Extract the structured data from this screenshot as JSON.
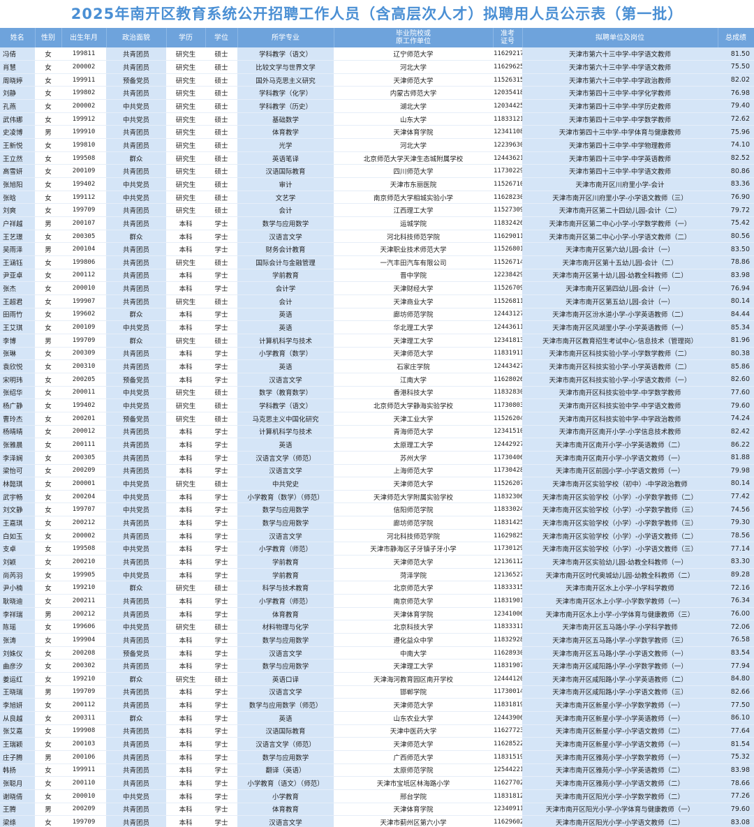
{
  "title": "2025年南开区教育系统公开招聘工作人员（含高层次人才）拟聘用人员公示表（第一批）",
  "headers": [
    "姓名",
    "性别",
    "出生年月",
    "政治面貌",
    "学历",
    "学位",
    "所学专业",
    "毕业院校或\n原工作单位",
    "准考\n证号",
    "拟聘单位及岗位",
    "总成绩"
  ],
  "rows": [
    [
      "冯倩",
      "女",
      "199811",
      "共青团员",
      "研究生",
      "硕士",
      "学科教学（语文）",
      "辽宁师范大学",
      "11629217",
      "天津市第六十三中学-中学语文教师",
      "81.50"
    ],
    [
      "肖慧",
      "女",
      "200002",
      "共青团员",
      "研究生",
      "硕士",
      "比较文学与世界文学",
      "河北大学",
      "11629625",
      "天津市第六十三中学-中学语文教师",
      "75.50"
    ],
    [
      "周晓婷",
      "女",
      "199911",
      "预备党员",
      "研究生",
      "硕士",
      "国外马克思主义研究",
      "天津师范大学",
      "11526315",
      "天津市第六十三中学-中学政治教师",
      "82.02"
    ],
    [
      "刘静",
      "女",
      "199802",
      "共青团员",
      "研究生",
      "硕士",
      "学科教学（化学）",
      "内蒙古师范大学",
      "12035418",
      "天津市第四十三中学-中学化学教师",
      "76.98"
    ],
    [
      "孔燕",
      "女",
      "200002",
      "中共党员",
      "研究生",
      "硕士",
      "学科教学（历史）",
      "湖北大学",
      "12034425",
      "天津市第四十三中学-中学历史教师",
      "79.40"
    ],
    [
      "武伟娜",
      "女",
      "199912",
      "中共党员",
      "研究生",
      "硕士",
      "基础数学",
      "山东大学",
      "11833121",
      "天津市第四十三中学-中学数学教师",
      "72.62"
    ],
    [
      "史凌博",
      "男",
      "199910",
      "共青团员",
      "研究生",
      "硕士",
      "体育教学",
      "天津体育学院",
      "12341108",
      "天津市第四十三中学-中学体育与健康教师",
      "75.96"
    ],
    [
      "王新悦",
      "女",
      "199810",
      "共青团员",
      "研究生",
      "硕士",
      "光学",
      "河北大学",
      "12239630",
      "天津市第四十三中学-中学物理教师",
      "74.10"
    ],
    [
      "王立然",
      "女",
      "199508",
      "群众",
      "研究生",
      "硕士",
      "英语笔译",
      "北京师范大学天津生态城附属学校",
      "12443621",
      "天津市第四十三中学-中学英语教师",
      "82.52"
    ],
    [
      "高雪妍",
      "女",
      "200109",
      "共青团员",
      "研究生",
      "硕士",
      "汉语国际教育",
      "四川师范大学",
      "11730229",
      "天津市第四十三中学-中学语文教师",
      "80.86"
    ],
    [
      "张旭阳",
      "女",
      "199402",
      "中共党员",
      "研究生",
      "硕士",
      "审计",
      "天津市东丽医院",
      "11526710",
      "天津市南开区川府里小学-会计",
      "83.36"
    ],
    [
      "张晗",
      "女",
      "199112",
      "中共党员",
      "研究生",
      "硕士",
      "文艺学",
      "南京师范大学相城实验小学",
      "11628230",
      "天津市南开区川府里小学-小学语文教师（三）",
      "76.90"
    ],
    [
      "刘爽",
      "女",
      "199709",
      "共青团员",
      "研究生",
      "硕士",
      "会计",
      "江西理工大学",
      "11527309",
      "天津市南开区第二十四幼儿园-会计（二）",
      "79.72"
    ],
    [
      "户祥越",
      "男",
      "200107",
      "共青团员",
      "本科",
      "学士",
      "数学与应用数学",
      "运城学院",
      "11832426",
      "天津市南开区第二中心小学-小学数学教师（一）",
      "75.42"
    ],
    [
      "王艺璟",
      "女",
      "200305",
      "群众",
      "本科",
      "学士",
      "汉语言文学",
      "河北科技师范学院",
      "11629011",
      "天津市南开区第二中心小学-小学语文教师（二）",
      "80.56"
    ],
    [
      "吴雨泽",
      "男",
      "200104",
      "共青团员",
      "本科",
      "学士",
      "财务会计教育",
      "天津职业技术师范大学",
      "11526801",
      "天津市南开区第六幼儿园-会计（一）",
      "83.50"
    ],
    [
      "王涵钰",
      "女",
      "199806",
      "共青团员",
      "研究生",
      "硕士",
      "国际会计与金融管理",
      "一汽丰田汽车有限公司",
      "11526714",
      "天津市南开区第十五幼儿园-会计（二）",
      "78.86"
    ],
    [
      "尹亚卓",
      "女",
      "200112",
      "共青团员",
      "本科",
      "学士",
      "学前教育",
      "晋中学院",
      "12238429",
      "天津市南开区第十幼儿园-幼教全科教师（二）",
      "83.98"
    ],
    [
      "张杰",
      "女",
      "200010",
      "共青团员",
      "本科",
      "学士",
      "会计学",
      "天津财经大学",
      "11526709",
      "天津市南开区第四幼儿园-会计（一）",
      "76.94"
    ],
    [
      "王超君",
      "女",
      "199907",
      "共青团员",
      "研究生",
      "硕士",
      "会计",
      "天津商业大学",
      "11526811",
      "天津市南开区第五幼儿园-会计（一）",
      "80.14"
    ],
    [
      "田雨竹",
      "女",
      "199602",
      "群众",
      "本科",
      "学士",
      "英语",
      "廊坊师范学院",
      "12443127",
      "天津市南开区汾水道小学-小学英语教师（二）",
      "84.44"
    ],
    [
      "王艾琪",
      "女",
      "200109",
      "中共党员",
      "本科",
      "学士",
      "英语",
      "华北理工大学",
      "12443611",
      "天津市南开区风湖里小学-小学英语教师（一）",
      "85.34"
    ],
    [
      "李博",
      "男",
      "199709",
      "群众",
      "研究生",
      "硕士",
      "计算机科学与技术",
      "天津理工大学",
      "12341813",
      "天津市南开区教育招生考试中心-信息技术（管理岗）",
      "81.96"
    ],
    [
      "张琳",
      "女",
      "200309",
      "共青团员",
      "本科",
      "学士",
      "小学教育（数学）",
      "天津师范大学",
      "11831911",
      "天津市南开区科技实验小学-小学数学教师（二）",
      "80.38"
    ],
    [
      "袁欣悦",
      "女",
      "200310",
      "共青团员",
      "本科",
      "学士",
      "英语",
      "石家庄学院",
      "12443427",
      "天津市南开区科技实验小学-小学英语教师（二）",
      "85.86"
    ],
    [
      "宋明玮",
      "女",
      "200205",
      "预备党员",
      "本科",
      "学士",
      "汉语言文学",
      "江南大学",
      "11628026",
      "天津市南开区科技实验小学-小学语文教师（一）",
      "82.60"
    ],
    [
      "张绍华",
      "女",
      "200011",
      "中共党员",
      "研究生",
      "硕士",
      "数学（教育数学）",
      "香港科技大学",
      "11832830",
      "天津市南开区科技实验中学-中学数学教师",
      "77.60"
    ],
    [
      "杨广静",
      "女",
      "199402",
      "中共党员",
      "研究生",
      "硕士",
      "学科教学（语文）",
      "北京师范大学静海实验学校",
      "11730803",
      "天津市南开区科技实验中学-中学语文教师",
      "79.60"
    ],
    [
      "曹玲杰",
      "女",
      "200201",
      "预备党员",
      "研究生",
      "硕士",
      "马克思主义中国化研究",
      "天津工业大学",
      "11526204",
      "天津市南开区科技实验中学-中学政治教师",
      "74.24"
    ],
    [
      "杨晴晴",
      "女",
      "200012",
      "共青团员",
      "本科",
      "学士",
      "计算机科学与技术",
      "青海师范大学",
      "12341510",
      "天津市南开区南开小学-小学信息技术教师",
      "82.42"
    ],
    [
      "张雅晨",
      "女",
      "200111",
      "共青团员",
      "本科",
      "学士",
      "英语",
      "太原理工大学",
      "12442927",
      "天津市南开区南开小学-小学英语教师（二）",
      "86.22"
    ],
    [
      "李泽娴",
      "女",
      "200305",
      "共青团员",
      "本科",
      "学士",
      "汉语言文学（师范）",
      "苏州大学",
      "11730406",
      "天津市南开区南开小学-小学语文教师（一）",
      "81.88"
    ],
    [
      "梁怡可",
      "女",
      "200209",
      "共青团员",
      "本科",
      "学士",
      "汉语言文学",
      "上海师范大学",
      "11730428",
      "天津市南开区前园小学-小学语文教师（一）",
      "79.98"
    ],
    [
      "林懿琪",
      "女",
      "200001",
      "中共党员",
      "研究生",
      "硕士",
      "中共党史",
      "天津师范大学",
      "11526207",
      "天津市南开区实验学校（初中）-中学政治教师",
      "80.14"
    ],
    [
      "武宇畅",
      "女",
      "200204",
      "中共党员",
      "本科",
      "学士",
      "小学教育（数学）（师范）",
      "天津师范大学附属实验学校",
      "11832306",
      "天津市南开区实验学校（小学）-小学数学教师（二）",
      "77.42"
    ],
    [
      "刘文静",
      "女",
      "199707",
      "中共党员",
      "本科",
      "学士",
      "数学与应用数学",
      "信阳师范学院",
      "11833024",
      "天津市南开区实验学校（小学）-小学数学教师（三）",
      "74.56"
    ],
    [
      "王嘉琪",
      "女",
      "200212",
      "共青团员",
      "本科",
      "学士",
      "数学与应用数学",
      "廊坊师范学院",
      "11831425",
      "天津市南开区实验学校（小学）-小学数学教师（三）",
      "79.30"
    ],
    [
      "白如玉",
      "女",
      "200002",
      "共青团员",
      "本科",
      "学士",
      "汉语言文学",
      "河北科技师范学院",
      "11629825",
      "天津市南开区实验学校（小学）-小学语文教师（二）",
      "78.56"
    ],
    [
      "支卓",
      "女",
      "199508",
      "中共党员",
      "本科",
      "学士",
      "小学教育（师范）",
      "天津市静海区子牙镇子牙小学",
      "11730129",
      "天津市南开区实验学校（小学）-小学语文教师（三）",
      "77.14"
    ],
    [
      "刘颖",
      "女",
      "200210",
      "共青团员",
      "本科",
      "学士",
      "学前教育",
      "天津师范大学",
      "12136112",
      "天津市南开区实验幼儿园-幼教全科教师（一）",
      "83.30"
    ],
    [
      "尚芮羽",
      "女",
      "199905",
      "中共党员",
      "本科",
      "学士",
      "学前教育",
      "菏泽学院",
      "12136527",
      "天津市南开区时代奥城幼儿园-幼教全科教师（二）",
      "89.28"
    ],
    [
      "尹小楠",
      "女",
      "199210",
      "群众",
      "研究生",
      "硕士",
      "科学与技术教育",
      "北京师范大学",
      "11833315",
      "天津市南开区水上小学-小学科学教师",
      "72.16"
    ],
    [
      "耿晓迪",
      "女",
      "200211",
      "共青团员",
      "本科",
      "学士",
      "小学教育（师范）",
      "南京师范大学",
      "11831901",
      "天津市南开区水上小学-小学数学教师（一）",
      "76.34"
    ],
    [
      "李祥瑞",
      "男",
      "200212",
      "共青团员",
      "本科",
      "学士",
      "体育教育",
      "天津体育学院",
      "12341006",
      "天津市南开区水上小学-小学体育与健康教师（三）",
      "76.00"
    ],
    [
      "陈瑶",
      "女",
      "199606",
      "中共党员",
      "研究生",
      "硕士",
      "材料物理与化学",
      "北京科技大学",
      "11833311",
      "天津市南开区五马路小学-小学科学教师",
      "72.06"
    ],
    [
      "张涛",
      "女",
      "199904",
      "共青团员",
      "本科",
      "学士",
      "数学与应用数学",
      "遵化益众中学",
      "11832928",
      "天津市南开区五马路小学-小学数学教师（三）",
      "76.58"
    ],
    [
      "刘姝仪",
      "女",
      "200208",
      "预备党员",
      "本科",
      "学士",
      "汉语言文学",
      "中南大学",
      "11628930",
      "天津市南开区五马路小学-小学语文教师（一）",
      "83.54"
    ],
    [
      "曲彦汐",
      "女",
      "200302",
      "共青团员",
      "本科",
      "学士",
      "数学与应用数学",
      "天津理工大学",
      "11831907",
      "天津市南开区咸阳路小学-小学数学教师（一）",
      "77.94"
    ],
    [
      "姜运红",
      "女",
      "199210",
      "群众",
      "研究生",
      "硕士",
      "英语口译",
      "天津海河教育园区南开学校",
      "12444120",
      "天津市南开区咸阳路小学-小学英语教师（二）",
      "84.80"
    ],
    [
      "王晓瑞",
      "男",
      "199709",
      "共青团员",
      "本科",
      "学士",
      "汉语言文学",
      "邯郸学院",
      "11730014",
      "天津市南开区咸阳路小学-小学语文教师（三）",
      "82.66"
    ],
    [
      "李旭妍",
      "女",
      "200112",
      "共青团员",
      "本科",
      "学士",
      "数学与应用数学（师范）",
      "天津师范大学",
      "11831819",
      "天津市南开区新星小学-小学数学教师（一）",
      "77.50"
    ],
    [
      "从良越",
      "女",
      "200311",
      "群众",
      "本科",
      "学士",
      "英语",
      "山东农业大学",
      "12443906",
      "天津市南开区新星小学-小学英语教师（一）",
      "86.10"
    ],
    [
      "张艾嘉",
      "女",
      "199908",
      "共青团员",
      "本科",
      "学士",
      "汉语国际教育",
      "天津中医药大学",
      "11627723",
      "天津市南开区新星小学-小学语文教师（二）",
      "77.64"
    ],
    [
      "王瑞颖",
      "女",
      "200103",
      "共青团员",
      "本科",
      "学士",
      "汉语言文学（师范）",
      "天津师范大学",
      "11628522",
      "天津市南开区新星小学-小学语文教师（一）",
      "81.54"
    ],
    [
      "庄子腾",
      "男",
      "200106",
      "共青团员",
      "本科",
      "学士",
      "数学与应用数学",
      "广西师范大学",
      "11831519",
      "天津市南开区雅苑小学-小学数学教师（一）",
      "75.32"
    ],
    [
      "韩扬",
      "女",
      "199911",
      "共青团员",
      "本科",
      "学士",
      "翻译（英语）",
      "太原师范学院",
      "12544221",
      "天津市南开区雅苑小学-小学英语教师（二）",
      "83.98"
    ],
    [
      "张聪月",
      "女",
      "200110",
      "共青团员",
      "本科",
      "学士",
      "小学教育（语文）（师范）",
      "天津市宝坻区林海路小学",
      "11627702",
      "天津市南开区雅苑小学-小学语文教师（二）",
      "78.66"
    ],
    [
      "谢晓倩",
      "女",
      "200010",
      "中共党员",
      "本科",
      "学士",
      "小学教育",
      "邢台学院",
      "11831812",
      "天津市南开区阳光小学-小学数学教师（二）",
      "77.26"
    ],
    [
      "王腾",
      "男",
      "200209",
      "共青团员",
      "本科",
      "学士",
      "体育教育",
      "天津体育学院",
      "12340911",
      "天津市南开区阳光小学-小学体育与健康教师（一）",
      "79.60"
    ],
    [
      "梁绦",
      "女",
      "199709",
      "共青团员",
      "本科",
      "学士",
      "汉语言文学",
      "天津市蓟州区第六小学",
      "11629602",
      "天津市南开区阳光小学-小学语文教师（二）",
      "83.08"
    ]
  ]
}
